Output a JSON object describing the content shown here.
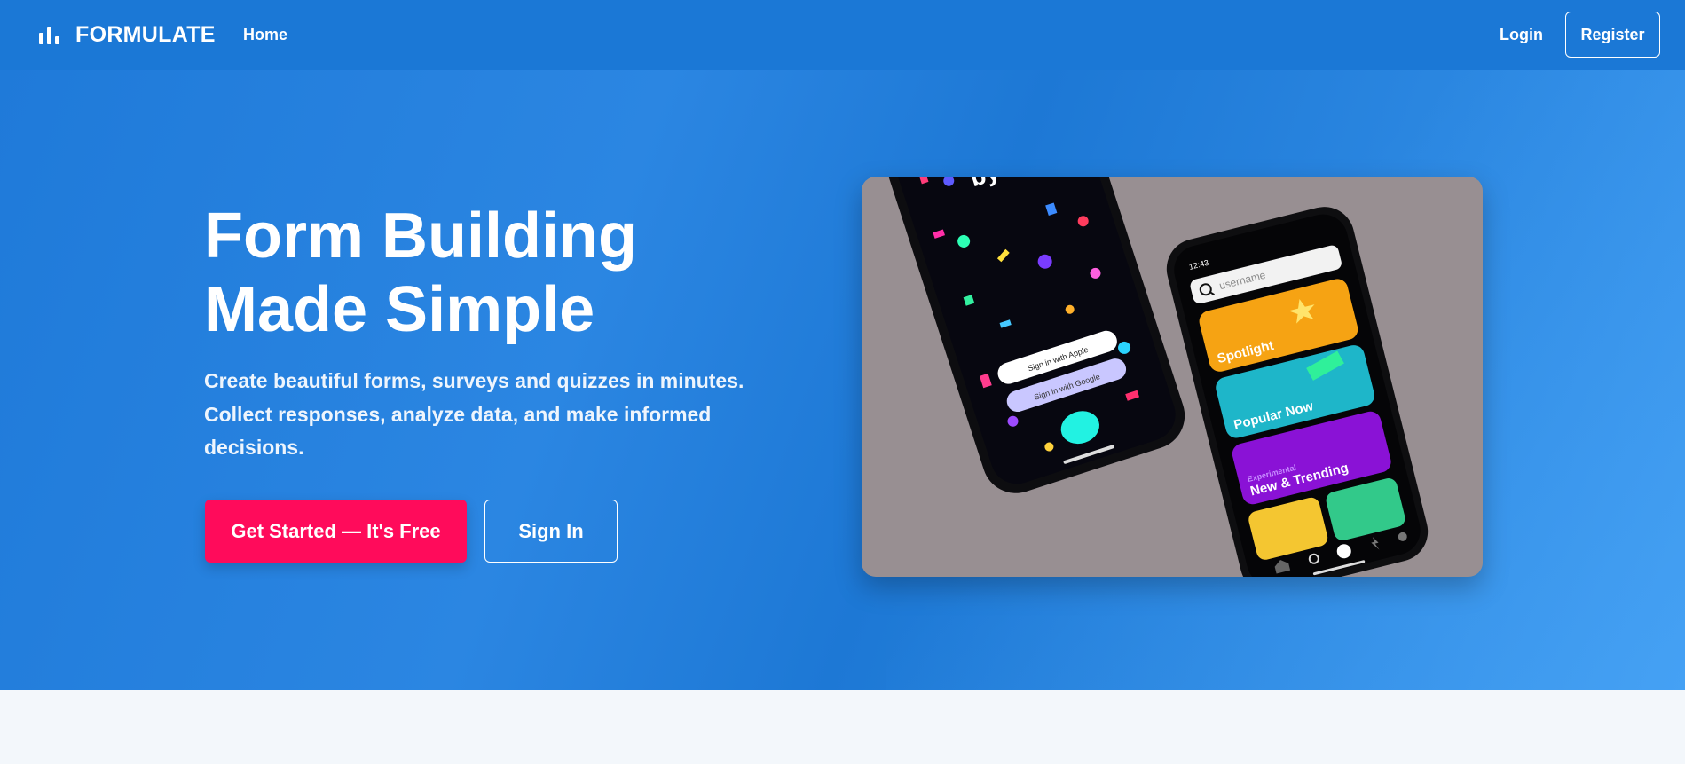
{
  "nav": {
    "brand": "FORMULATE",
    "home": "Home",
    "login": "Login",
    "register": "Register"
  },
  "hero": {
    "title_line1": "Form Building",
    "title_line2": "Made Simple",
    "subtitle": "Create beautiful forms, surveys and quizzes in minutes. Collect responses, analyze data, and make informed decisions.",
    "cta_primary": "Get Started — It's Free",
    "cta_secondary": "Sign In"
  },
  "phone_left": {
    "logo": "byte",
    "apple_button": "Sign in with Apple",
    "google_button": "Sign in with Google"
  },
  "phone_right": {
    "time": "12:43",
    "search_placeholder": "username",
    "cards": [
      {
        "label": "Spotlight",
        "color": "#f6a313"
      },
      {
        "label": "Popular Now",
        "color": "#1eb6c9"
      },
      {
        "label": "New & Trending",
        "sublabel": "Experimental",
        "color": "#8a12d6"
      }
    ]
  },
  "colors": {
    "nav_bg": "#1b78d6",
    "primary_button": "#ff0b5b",
    "image_bg": "#988f92"
  }
}
